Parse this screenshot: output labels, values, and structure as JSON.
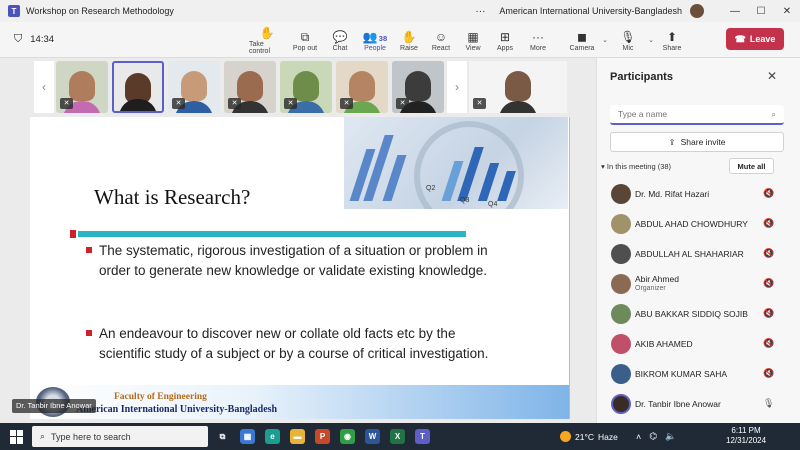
{
  "window": {
    "title": "Workshop on Research Methodology",
    "org": "American International University-Bangladesh",
    "more": "···",
    "minimize": "—",
    "maximize": "☐",
    "close": "✕"
  },
  "meeting_toolbar": {
    "timer": "14:34",
    "tools": [
      {
        "label": "Take control",
        "icon": "✋",
        "name": "take-control-button"
      },
      {
        "label": "Pop out",
        "icon": "⧉",
        "name": "pop-out-button"
      },
      {
        "label": "Chat",
        "icon": "💬",
        "name": "chat-button"
      },
      {
        "label": "People",
        "icon": "👥",
        "name": "people-button",
        "count": "38",
        "active": true
      },
      {
        "label": "Raise",
        "icon": "✋",
        "name": "raise-hand-button"
      },
      {
        "label": "React",
        "icon": "☺",
        "name": "react-button"
      },
      {
        "label": "View",
        "icon": "▦",
        "name": "view-button"
      },
      {
        "label": "Apps",
        "icon": "⊞",
        "name": "apps-button"
      },
      {
        "label": "More",
        "icon": "···",
        "name": "more-button"
      },
      {
        "label": "Camera",
        "icon": "◼",
        "name": "camera-button",
        "caret": true
      },
      {
        "label": "Mic",
        "icon": "🎙",
        "name": "mic-button",
        "caret": true
      },
      {
        "label": "Share",
        "icon": "⬆",
        "name": "share-button"
      }
    ],
    "leave_label": "Leave"
  },
  "thumbnails": [
    {
      "face": "#b07c5e",
      "body": "#c26bb0",
      "bg": "#cfd7c4",
      "muted": true
    },
    {
      "face": "#5a3b2a",
      "body": "#1e1e1e",
      "bg": "#e9e9e9",
      "muted": false,
      "selected": true
    },
    {
      "face": "#c79a78",
      "body": "#2f5fa3",
      "bg": "#e4e9ee",
      "muted": true
    },
    {
      "face": "#9b6b4f",
      "body": "#333333",
      "bg": "#d6d2cc",
      "muted": true
    },
    {
      "face": "#6f8d4a",
      "body": "#3a6ea8",
      "bg": "#c9d9b8",
      "muted": true
    },
    {
      "face": "#b58563",
      "body": "#6aa84f",
      "bg": "#e3d9c6",
      "muted": true
    },
    {
      "face": "#3c3c3c",
      "body": "#222222",
      "bg": "#bfc5c9",
      "muted": true
    },
    {
      "face": "#7b5a45",
      "body": "#333333",
      "bg": "#f4f4f4",
      "muted": true
    }
  ],
  "slide": {
    "title": "What is Research?",
    "bullets": [
      "The systematic, rigorous investigation of a situation or problem in order to generate new knowledge or validate existing knowledge.",
      "An endeavour to discover new or collate old facts etc by the scientific study of a subject or by a course of critical investigation."
    ],
    "footer_faculty": "Faculty of Engineering",
    "footer_university": "American International University-Bangladesh",
    "chart_labels": [
      "Q2",
      "Q3",
      "Q4"
    ],
    "presenter_name": "Dr. Tanbir Ibne Anowar"
  },
  "panel": {
    "title": "Participants",
    "search_placeholder": "Type a name",
    "share_invite": "Share invite",
    "in_meeting": "In this meeting (38)",
    "mute_all": "Mute all",
    "participants": [
      {
        "name": "Dr. Md. Rifat Hazari",
        "role": "",
        "avatar": "#5a4636",
        "mic": "muted"
      },
      {
        "name": "ABDUL AHAD CHOWDHURY",
        "role": "",
        "avatar": "#a0936b",
        "mic": "muted"
      },
      {
        "name": "ABDULLAH AL SHAHARIAR",
        "role": "",
        "avatar": "#4f4f4f",
        "mic": "muted"
      },
      {
        "name": "Abir Ahmed",
        "role": "Organizer",
        "avatar": "#8a6a52",
        "mic": "muted"
      },
      {
        "name": "ABU BAKKAR SIDDIQ SOJIB",
        "role": "",
        "avatar": "#6d8a5a",
        "mic": "muted"
      },
      {
        "name": "AKIB AHAMED",
        "role": "",
        "avatar": "#c0506a",
        "mic": "muted"
      },
      {
        "name": "BIKROM KUMAR SAHA",
        "role": "",
        "avatar": "#3b5f8a",
        "mic": "muted"
      },
      {
        "name": "Dr. Tanbir Ibne Anowar",
        "role": "",
        "avatar": "#3a2c24",
        "mic": "on",
        "ring": true
      }
    ]
  },
  "taskbar": {
    "search_placeholder": "Type here to search",
    "weather_temp": "21°C",
    "weather_desc": "Haze",
    "time": "6:11 PM",
    "date": "12/31/2024",
    "apps": [
      {
        "name": "task-view-icon",
        "glyph": "⧉",
        "color": "#1f2a36"
      },
      {
        "name": "microsoft-store-icon",
        "glyph": "▦",
        "color": "#3a78d4"
      },
      {
        "name": "edge-icon",
        "glyph": "e",
        "color": "#1a9e8f"
      },
      {
        "name": "file-explorer-icon",
        "glyph": "▬",
        "color": "#e7b43a"
      },
      {
        "name": "powerpoint-icon",
        "glyph": "P",
        "color": "#c64a2a"
      },
      {
        "name": "chrome-icon",
        "glyph": "◉",
        "color": "#2f9e44"
      },
      {
        "name": "word-icon",
        "glyph": "W",
        "color": "#2b579a"
      },
      {
        "name": "excel-icon",
        "glyph": "X",
        "color": "#217346"
      },
      {
        "name": "teams-icon",
        "glyph": "T",
        "color": "#5b5fc7"
      }
    ]
  }
}
